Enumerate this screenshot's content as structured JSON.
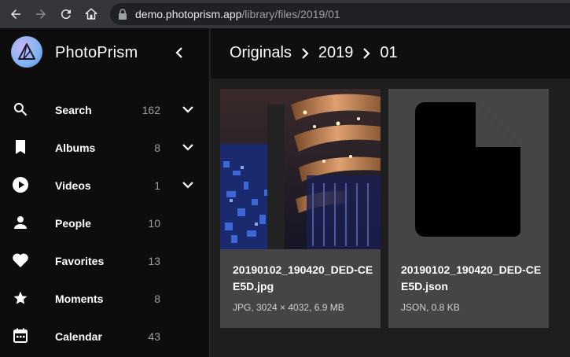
{
  "browser": {
    "url_host": "demo.photoprism.app",
    "url_path": "/library/files/2019/01",
    "icons": [
      "back-arrow-icon",
      "forward-arrow-icon",
      "reload-icon",
      "home-icon",
      "lock-icon"
    ]
  },
  "app": {
    "brand": "PhotoPrism",
    "brand_colors": [
      "#c7b6f7",
      "#7fb3f0"
    ]
  },
  "sidebar": {
    "items": [
      {
        "label": "Search",
        "count": "162",
        "icon": "search-icon",
        "expandable": true
      },
      {
        "label": "Albums",
        "count": "8",
        "icon": "bookmark-icon",
        "expandable": true
      },
      {
        "label": "Videos",
        "count": "1",
        "icon": "play-circle-icon",
        "expandable": true
      },
      {
        "label": "People",
        "count": "10",
        "icon": "person-icon",
        "expandable": false
      },
      {
        "label": "Favorites",
        "count": "13",
        "icon": "heart-icon",
        "expandable": false
      },
      {
        "label": "Moments",
        "count": "8",
        "icon": "star-icon",
        "expandable": false
      },
      {
        "label": "Calendar",
        "count": "43",
        "icon": "calendar-icon",
        "expandable": false
      }
    ]
  },
  "breadcrumb": [
    "Originals",
    "2019",
    "01"
  ],
  "files": [
    {
      "name": "20190102_190420_DED-CEE5D.jpg",
      "meta": "JPG, 3024 × 4032, 6.9 MB",
      "thumb": "photo"
    },
    {
      "name": "20190102_190420_DED-CEE5D.json",
      "meta": "JSON, 0.8 KB",
      "thumb": "file-icon"
    }
  ]
}
